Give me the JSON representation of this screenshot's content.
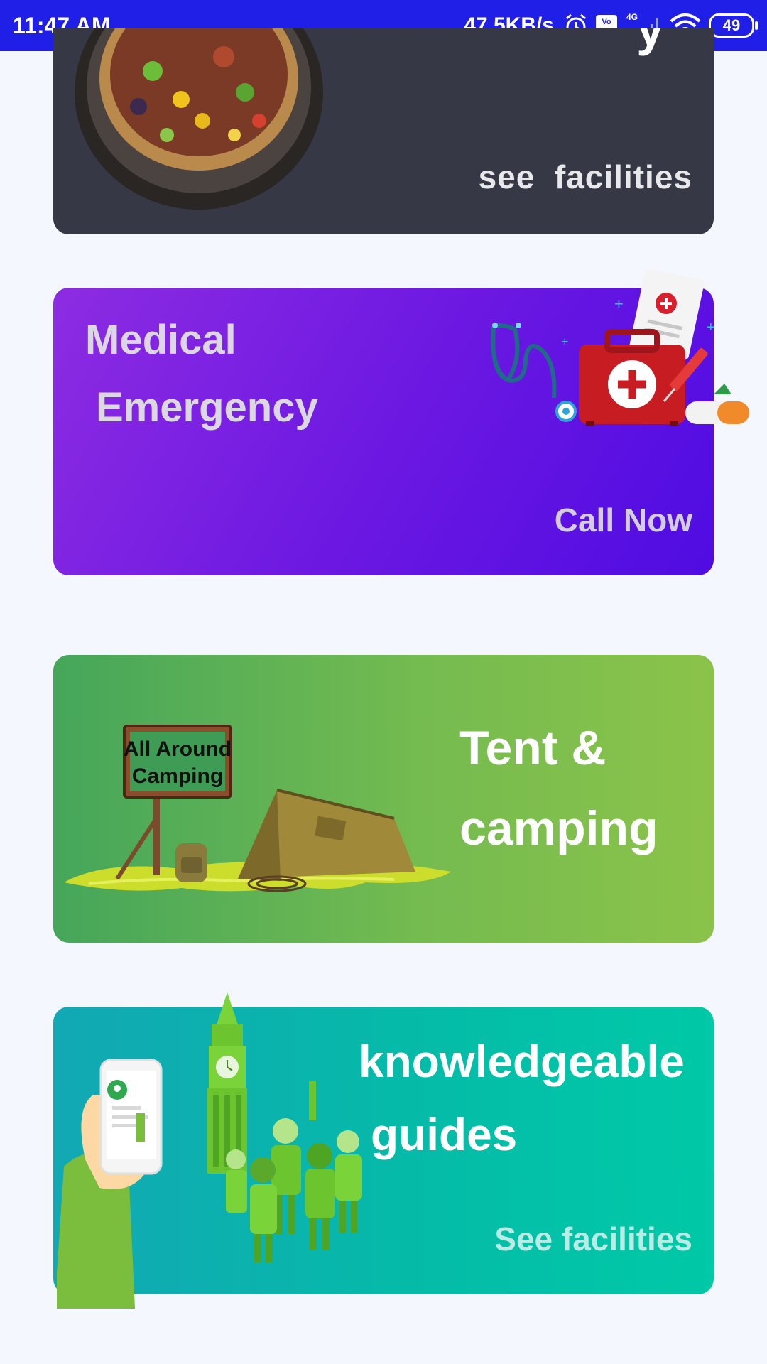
{
  "status_bar": {
    "time": "11:47 AM",
    "net_speed": "47.5KB/s",
    "volte": "Vo LTE",
    "network": "4G",
    "battery": "49"
  },
  "cards": {
    "food": {
      "action_label": "see  facilities",
      "partial_title": "y"
    },
    "medical": {
      "title_line1": "Medical",
      "title_line2": "Emergency",
      "action_label": "Call Now"
    },
    "tent": {
      "title_line1": "Tent &",
      "title_line2": "camping",
      "sign_line1": "All Around",
      "sign_line2": "Camping"
    },
    "guides": {
      "title_line1": "knowledgeable",
      "title_line2": "guides",
      "action_label": "See facilities"
    }
  },
  "colors": {
    "status_bar": "#1f1fe8",
    "food_card": "#363945",
    "medical_gradient": [
      "#8d2ce2",
      "#4f0ce2"
    ],
    "tent_gradient": [
      "#45a65a",
      "#8bc34a"
    ],
    "guides_gradient": [
      "#12a8b4",
      "#00c9a7"
    ]
  },
  "icons": [
    "alarm-icon",
    "volte-icon",
    "signal-icon",
    "wifi-icon",
    "battery-icon"
  ]
}
